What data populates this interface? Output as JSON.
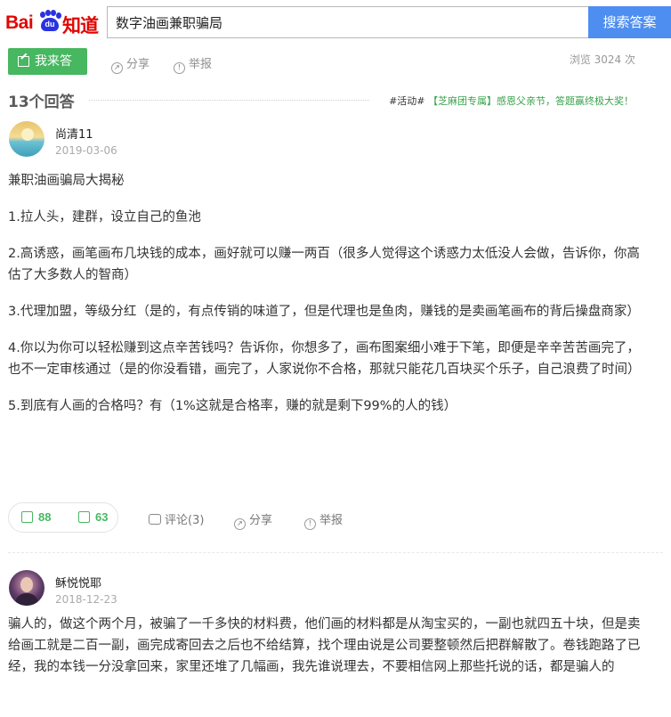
{
  "header": {
    "logo_text": "Bai du 知道",
    "search_query": "数字油画兼职骗局",
    "search_button": "搜索答案"
  },
  "toolbar": {
    "answer_label": "我来答",
    "share_label": "分享",
    "report_label": "举报",
    "views": "浏览 3024 次"
  },
  "answers_header": {
    "count": "13个回答",
    "promo_tag": "#活动#",
    "promo_text": "【芝麻团专属】感恩父亲节，答题赢终极大奖！"
  },
  "answers": [
    {
      "user": "尚清11",
      "date": "2019-03-06",
      "paragraphs": [
        "兼职油画骗局大揭秘",
        "1.拉人头，建群，设立自己的鱼池",
        "2.高诱惑，画笔画布几块钱的成本，画好就可以赚一两百（很多人觉得这个诱惑力太低没人会做，告诉你，你高估了大多数人的智商）",
        "3.代理加盟，等级分红（是的，有点传销的味道了，但是代理也是鱼肉，赚钱的是卖画笔画布的背后操盘商家）",
        "4.你以为你可以轻松赚到这点辛苦钱吗？告诉你，你想多了，画布图案细小难于下笔，即便是辛辛苦苦画完了，也不一定审核通过（是的你没看错，画完了，人家说你不合格，那就只能花几百块买个乐子，自己浪费了时间）",
        "5.到底有人画的合格吗？有（1%这就是合格率，赚的就是剩下99%的人的钱）"
      ],
      "likes": "88",
      "dislikes": "63",
      "comment_label": "评论(3)",
      "share_label": "分享",
      "report_label": "举报"
    },
    {
      "user": "稣悦悦耶",
      "date": "2018-12-23",
      "paragraphs": [
        "骗人的，做这个两个月，被骗了一千多快的材料费，他们画的材料都是从淘宝买的，一副也就四五十块，但是卖给画工就是二百一副，画完成寄回去之后也不给结算，找个理由说是公司要整顿然后把群解散了。卷钱跑路了已经，我的本钱一分没拿回来，家里还堆了几幅画，我先谁说理去，不要相信网上那些托说的话，都是骗人的"
      ]
    }
  ],
  "colors": {
    "brand_red": "#e10601",
    "brand_blue": "#2932e1",
    "search_button": "#4e8ef0",
    "accent_green": "#47b760"
  }
}
